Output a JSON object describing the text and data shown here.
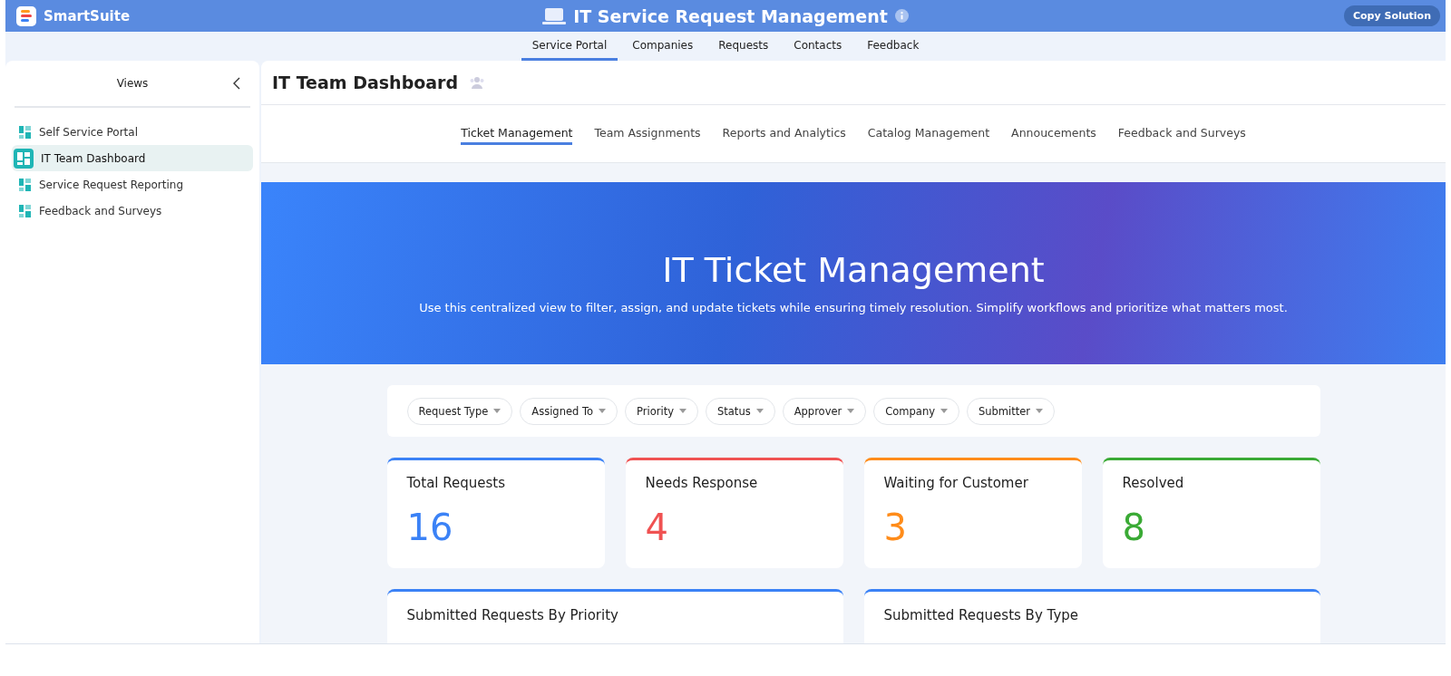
{
  "app": {
    "brand": "SmartSuite",
    "title": "IT Service Request Management",
    "action": "Copy Solution"
  },
  "nav": [
    {
      "label": "Service Portal",
      "selected": true
    },
    {
      "label": "Companies",
      "selected": false
    },
    {
      "label": "Requests",
      "selected": false
    },
    {
      "label": "Contacts",
      "selected": false
    },
    {
      "label": "Feedback",
      "selected": false
    }
  ],
  "sidebar": {
    "title": "Views",
    "items": [
      {
        "label": "Self Service Portal",
        "selected": false
      },
      {
        "label": "IT Team Dashboard",
        "selected": true
      },
      {
        "label": "Service Request Reporting",
        "selected": false
      },
      {
        "label": "Feedback and Surveys",
        "selected": false
      }
    ]
  },
  "page": {
    "title": "IT Team Dashboard"
  },
  "tabs": [
    {
      "label": "Ticket Management",
      "selected": true
    },
    {
      "label": "Team Assignments",
      "selected": false
    },
    {
      "label": "Reports and Analytics",
      "selected": false
    },
    {
      "label": "Catalog Management",
      "selected": false
    },
    {
      "label": "Annoucements",
      "selected": false
    },
    {
      "label": "Feedback and Surveys",
      "selected": false
    }
  ],
  "banner": {
    "title": "IT Ticket Management",
    "subtitle": "Use this centralized view to filter, assign, and update tickets while ensuring timely resolution. Simplify workflows and prioritize what matters most."
  },
  "filters": [
    "Request Type",
    "Assigned To",
    "Priority",
    "Status",
    "Approver",
    "Company",
    "Submitter"
  ],
  "stats": [
    {
      "label": "Total Requests",
      "value": "16",
      "color": "#3b82f6"
    },
    {
      "label": "Needs Response",
      "value": "4",
      "color": "#f05252"
    },
    {
      "label": "Waiting for Customer",
      "value": "3",
      "color": "#ff8c1a"
    },
    {
      "label": "Resolved",
      "value": "8",
      "color": "#3aaa35"
    }
  ],
  "panels": [
    {
      "title": "Submitted Requests By Priority"
    },
    {
      "title": "Submitted Requests By Type"
    }
  ]
}
